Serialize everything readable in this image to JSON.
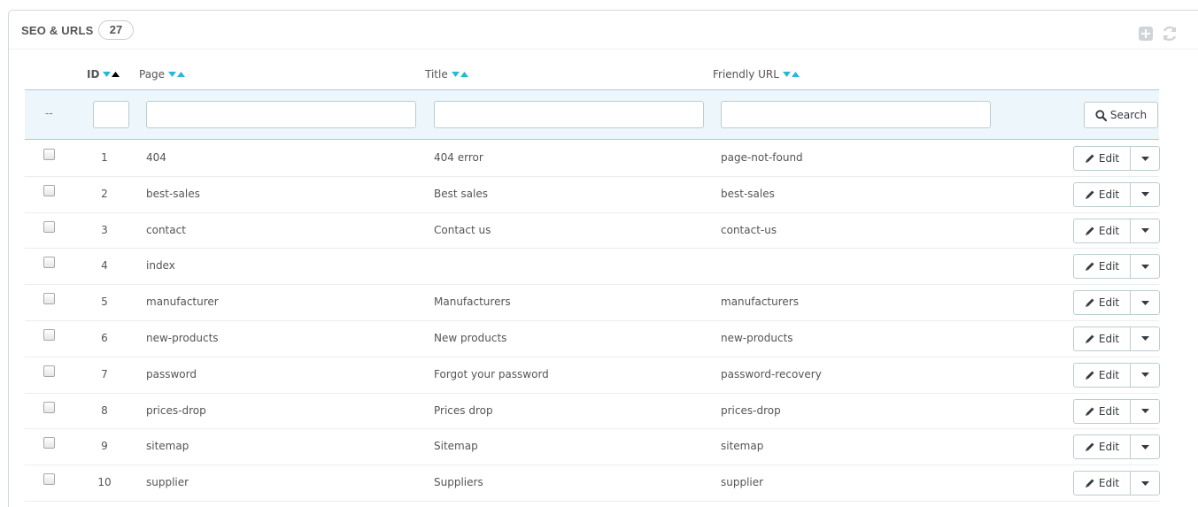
{
  "panel": {
    "title": "SEO & URLS",
    "count": "27"
  },
  "columns": {
    "id": "ID",
    "page": "Page",
    "title": "Title",
    "friendly_url": "Friendly URL"
  },
  "filters": {
    "dash": "--",
    "search_label": "Search"
  },
  "row_action": {
    "edit_label": "Edit"
  },
  "rows": [
    {
      "id": "1",
      "page": "404",
      "title": "404 error",
      "url": "page-not-found"
    },
    {
      "id": "2",
      "page": "best-sales",
      "title": "Best sales",
      "url": "best-sales"
    },
    {
      "id": "3",
      "page": "contact",
      "title": "Contact us",
      "url": "contact-us"
    },
    {
      "id": "4",
      "page": "index",
      "title": "",
      "url": ""
    },
    {
      "id": "5",
      "page": "manufacturer",
      "title": "Manufacturers",
      "url": "manufacturers"
    },
    {
      "id": "6",
      "page": "new-products",
      "title": "New products",
      "url": "new-products"
    },
    {
      "id": "7",
      "page": "password",
      "title": "Forgot your password",
      "url": "password-recovery"
    },
    {
      "id": "8",
      "page": "prices-drop",
      "title": "Prices drop",
      "url": "prices-drop"
    },
    {
      "id": "9",
      "page": "sitemap",
      "title": "Sitemap",
      "url": "sitemap"
    },
    {
      "id": "10",
      "page": "supplier",
      "title": "Suppliers",
      "url": "supplier"
    }
  ],
  "colors": {
    "sort_arrow": "#25b9d7",
    "filter_bg": "#ecf6fb",
    "filter_border": "#a0d0eb",
    "text": "#555555"
  },
  "icons": {
    "add": "plus-square-icon",
    "refresh": "refresh-icon",
    "search": "search-icon",
    "edit": "pencil-icon",
    "dropdown": "caret-down-icon"
  }
}
